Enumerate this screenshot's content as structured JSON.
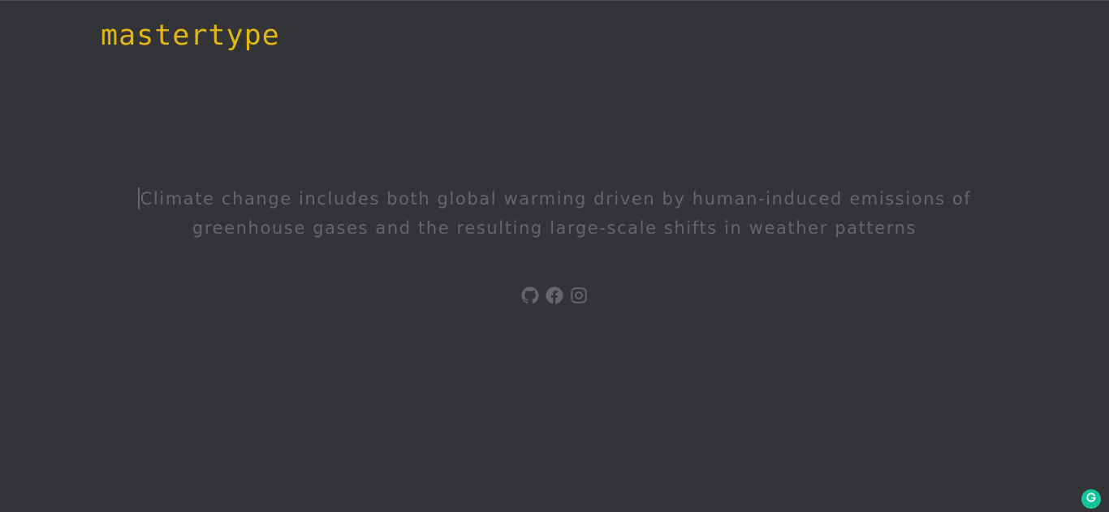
{
  "header": {
    "logo_text": "mastertype"
  },
  "typing": {
    "text": "Climate change includes both global warming driven by human-induced emissions of greenhouse gases and the resulting large-scale shifts in weather patterns"
  },
  "socials": {
    "items": [
      {
        "name": "github",
        "icon": "github-icon"
      },
      {
        "name": "facebook",
        "icon": "facebook-icon"
      },
      {
        "name": "instagram",
        "icon": "instagram-icon"
      }
    ]
  },
  "extension": {
    "icon": "grammarly-icon"
  },
  "colors": {
    "background": "#323437",
    "accent": "#e2b714",
    "sub_text": "#646669",
    "grammarly": "#15c39a"
  }
}
